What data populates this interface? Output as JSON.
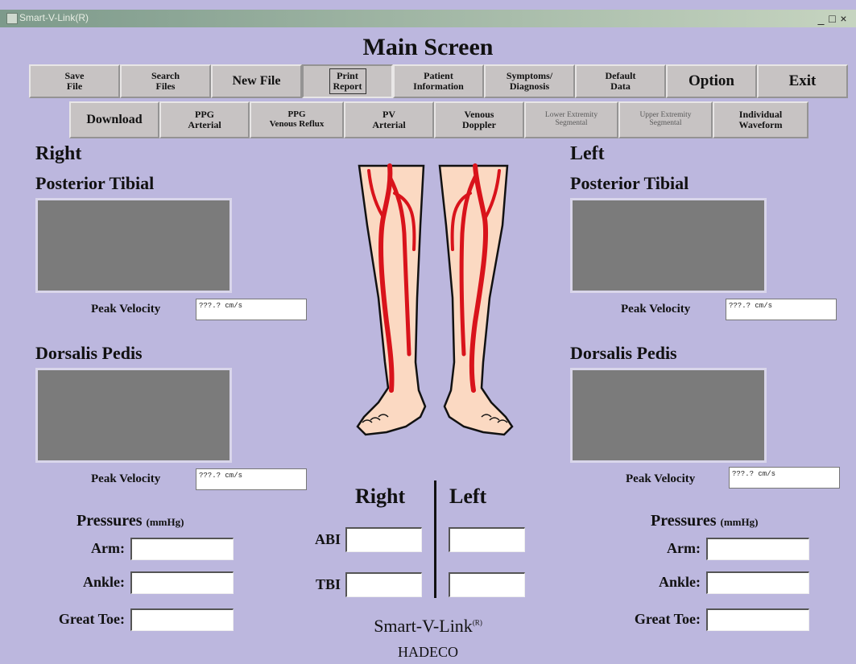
{
  "window": {
    "title": "Smart-V-Link(R)",
    "controls": [
      "_",
      "□",
      "×"
    ]
  },
  "screen_title": "Main Screen",
  "toolbar_top": [
    {
      "l1": "Save",
      "l2": "File"
    },
    {
      "l1": "Search",
      "l2": "Files"
    },
    {
      "l1": "New File",
      "l2": ""
    },
    {
      "l1": "Print",
      "l2": "Report"
    },
    {
      "l1": "Patient",
      "l2": "Information"
    },
    {
      "l1": "Symptoms/",
      "l2": "Diagnosis"
    },
    {
      "l1": "Default",
      "l2": "Data"
    },
    {
      "l1": "Option",
      "l2": ""
    },
    {
      "l1": "Exit",
      "l2": ""
    }
  ],
  "toolbar_bottom": [
    {
      "l1": "Download",
      "l2": ""
    },
    {
      "l1": "PPG",
      "l2": "Arterial"
    },
    {
      "l1": "PPG",
      "l2": "Venous Reflux"
    },
    {
      "l1": "PV",
      "l2": "Arterial"
    },
    {
      "l1": "Venous",
      "l2": "Doppler"
    },
    {
      "l1": "Lower Extremity",
      "l2": "Segmental"
    },
    {
      "l1": "Upper Extremity",
      "l2": "Segmental"
    },
    {
      "l1": "Individual",
      "l2": "Waveform"
    }
  ],
  "right": {
    "heading": "Right",
    "posterior": "Posterior Tibial",
    "dorsalis": "Dorsalis Pedis",
    "peak_label": "Peak Velocity",
    "peak_pt": "???.? cm/s",
    "peak_dp": "???.? cm/s",
    "pressures": "Pressures",
    "unit": "(mmHg)",
    "arm": "Arm:",
    "ankle": "Ankle:",
    "toe": "Great Toe:"
  },
  "left": {
    "heading": "Left",
    "posterior": "Posterior Tibial",
    "dorsalis": "Dorsalis Pedis",
    "peak_label": "Peak Velocity",
    "peak_pt": "???.? cm/s",
    "peak_dp": "???.? cm/s",
    "pressures": "Pressures",
    "unit": "(mmHg)",
    "arm": "Arm:",
    "ankle": "Ankle:",
    "toe": "Great Toe:"
  },
  "index": {
    "right": "Right",
    "left": "Left",
    "abi": "ABI",
    "tbi": "TBI"
  },
  "brand": {
    "name": "Smart-V-Link",
    "mark": "(R)",
    "company": "HADECO"
  },
  "colors": {
    "background": "#bcb7de",
    "button": "#c7c3c3",
    "waveform": "#7b7b7b",
    "vessel": "#d9131b",
    "skin": "#fbd9c2"
  }
}
